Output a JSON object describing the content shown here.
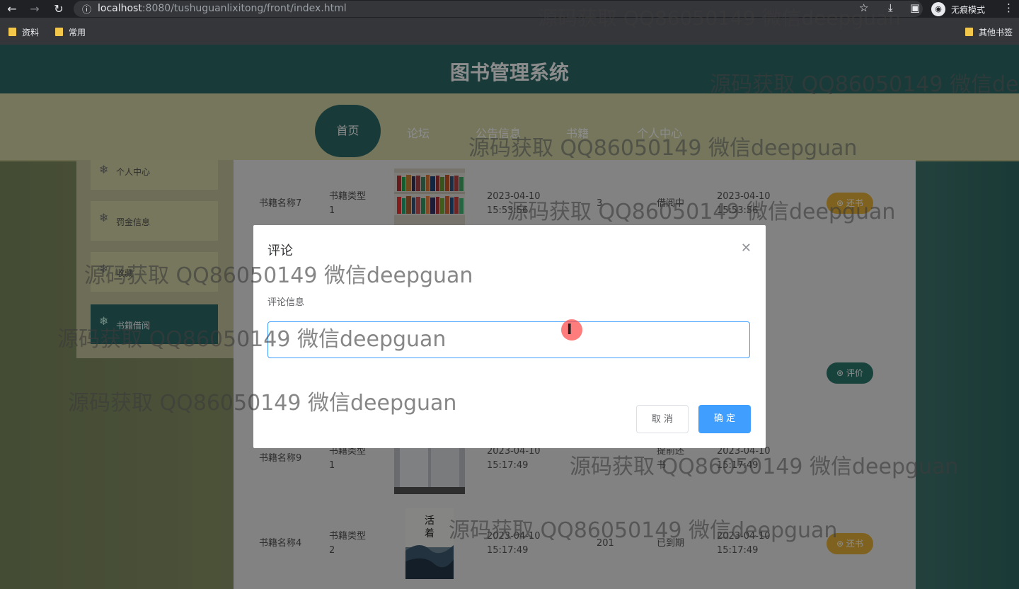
{
  "browser": {
    "url_host": "localhost",
    "url_rest": ":8080/tushuguanlixitong/front/index.html",
    "incognito_label": "无痕模式",
    "bookmarks": [
      "资料",
      "常用"
    ],
    "other_bookmarks": "其他书签"
  },
  "site": {
    "title": "图书管理系统",
    "nav": [
      "首页",
      "论坛",
      "公告信息",
      "书籍",
      "个人中心"
    ]
  },
  "sidebar": {
    "items": [
      {
        "label": "个人中心"
      },
      {
        "label": "罚金信息"
      },
      {
        "label": "收藏"
      },
      {
        "label": "书籍借阅"
      }
    ]
  },
  "table": {
    "rows": [
      {
        "name": "书籍名称7",
        "type": "书籍类型\n1",
        "date1": "2023-04-10\n15:53:56",
        "count": "3",
        "status": "借阅中",
        "date2": "2023-04-10\n15:53:56",
        "action": "还书"
      },
      {
        "name": "书籍名称9",
        "type": "书籍类型\n1",
        "date1": "2023-04-10\n15:17:49",
        "count": "",
        "status": "提前还\n书",
        "date2": "2023-04-10\n15:17:49",
        "action": ""
      },
      {
        "name": "书籍名称4",
        "type": "书籍类型\n2",
        "date1": "2023-04-10\n15:17:49",
        "count": "201",
        "status": "已到期",
        "date2": "2023-04-10\n15:17:49",
        "action": "还书"
      }
    ],
    "middle_action": "评价"
  },
  "modal": {
    "title": "评论",
    "field_label": "评论信息",
    "input_value": "",
    "cancel_label": "取 消",
    "ok_label": "确 定"
  },
  "watermark": "源码获取 QQ86050149 微信deepguan",
  "colors": {
    "header": "#2d6a68",
    "navbar": "#d6d7a8",
    "primary": "#409eff",
    "pill_yellow": "#e7b33a",
    "pill_teal": "#2d7a6e"
  }
}
